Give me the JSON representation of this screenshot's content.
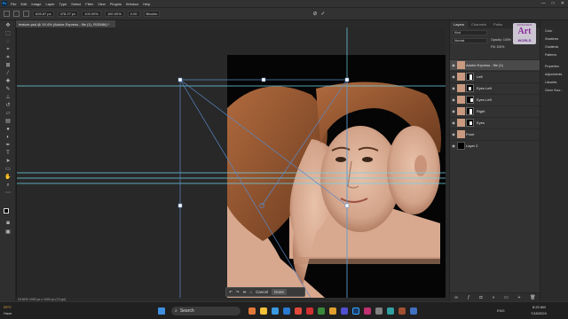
{
  "app": {
    "logo_text": "Ps",
    "menu": [
      "File",
      "Edit",
      "Image",
      "Layer",
      "Type",
      "Select",
      "Filter",
      "View",
      "Plugins",
      "Window",
      "Help"
    ],
    "window_controls": [
      "—",
      "□",
      "✕"
    ]
  },
  "options_bar": {
    "x_value": "626.87 px",
    "y_value": "378.27 px",
    "w_value": "100.00%",
    "h_value": "100.00%",
    "angle_value": "0.00",
    "interp_label": "Bicubic"
  },
  "document": {
    "tab_title": "feature.psd @ 19.4% (Adobe Express - file (1), RGB/8#) *",
    "status": "19.82%     1000 px x 1000 px (72 ppi)"
  },
  "transform_bar": {
    "undo_icon": "undo-icon",
    "redo_icon": "redo-icon",
    "cancel_label": "Cancel",
    "done_label": "Done"
  },
  "layers_panel": {
    "tabs": [
      "Layers",
      "Channels",
      "Paths"
    ],
    "blend_mode": "Normal",
    "opacity_label": "Opacity:",
    "opacity_value": "100%",
    "fill_label": "Fill:",
    "fill_value": "100%",
    "kind_label": "Kind",
    "layers": [
      {
        "name": "Adobe Express - file (1)",
        "selected": true
      },
      {
        "name": "Left",
        "selected": false
      },
      {
        "name": "Eyes Left",
        "selected": false
      },
      {
        "name": "Eyes Left",
        "selected": false
      },
      {
        "name": "Right",
        "selected": false
      },
      {
        "name": "Eyes",
        "selected": false
      },
      {
        "name": "Front",
        "selected": false
      },
      {
        "name": "Layer 2",
        "selected": false
      }
    ]
  },
  "right_panel": {
    "items": [
      "Color",
      "Swatches",
      "Gradients",
      "Patterns",
      "Properties",
      "Adjustments",
      "Libraries",
      "Clone Sour..."
    ]
  },
  "watermark": {
    "line1": "MARKETEERS",
    "line2": "Art",
    "line3": "WORLD"
  },
  "taskbar": {
    "search_placeholder": "Search",
    "weather_temp": "29°C",
    "weather_desc": "Haze",
    "time": "8:22 AM",
    "date": "7/18/2024",
    "lang": "ENG"
  },
  "colors": {
    "accent": "#31a8ff",
    "guide": "#6fd3e8",
    "transform_line": "#5b88c8",
    "selected_layer": "#4a4a4a"
  }
}
